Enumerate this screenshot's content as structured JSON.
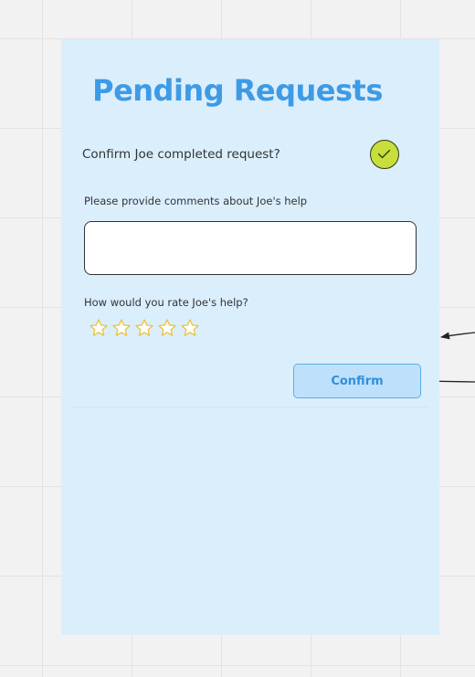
{
  "panel": {
    "title": "Pending Requests",
    "confirm_question": "Confirm Joe completed request?",
    "comments_label": "Please provide comments about Joe's help",
    "comments_value": "",
    "rating_label": "How would you rate Joe's help?",
    "rating": {
      "filled": 0,
      "max": 5
    },
    "confirm_button_label": "Confirm"
  },
  "icons": {
    "check": "check-circle-icon",
    "star": "star-outline-icon"
  },
  "colors": {
    "title": "#3d9be6",
    "panel_background": "#dbeefc",
    "check_fill": "#c8de3a",
    "star_stroke": "#e8c23a",
    "button_fill": "#bfe0fa",
    "button_text": "#2f8fdc"
  }
}
